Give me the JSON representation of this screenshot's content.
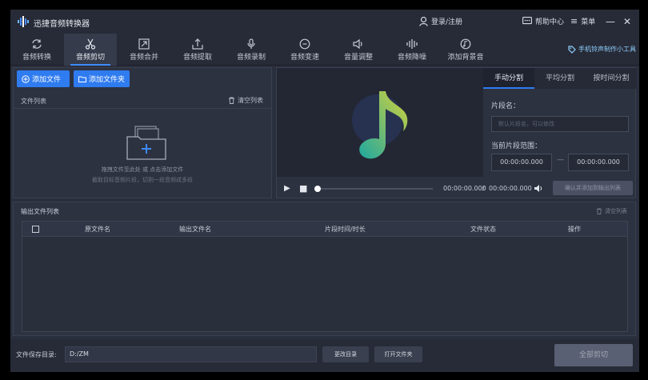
{
  "app": {
    "title": "迅捷音频转换器",
    "login": "登录/注册",
    "help": "帮助中心",
    "menu": "菜单",
    "accent": "#2f7bf0"
  },
  "toolbar": {
    "items": [
      {
        "label": "音频转换",
        "icon": "convert-icon"
      },
      {
        "label": "音频剪切",
        "icon": "scissors-icon"
      },
      {
        "label": "音频合并",
        "icon": "merge-icon"
      },
      {
        "label": "音频提取",
        "icon": "extract-icon"
      },
      {
        "label": "音频录制",
        "icon": "microphone-icon"
      },
      {
        "label": "音频变速",
        "icon": "speed-icon"
      },
      {
        "label": "音量调整",
        "icon": "volume-icon"
      },
      {
        "label": "音频降噪",
        "icon": "denoise-icon"
      },
      {
        "label": "添加背景音",
        "icon": "music-disc-icon"
      }
    ],
    "active": "音频剪切",
    "phone_tool": "手机铃声制作小工具"
  },
  "files": {
    "add_file": "添加文件",
    "add_folder": "添加文件夹",
    "list_label": "文件列表",
    "clear_list": "清空列表",
    "drop_hint_1": "拖拽文件至此处 或 点击添加文件",
    "drop_hint_2": "截取目标音频片段，切割一段音频成多段"
  },
  "player": {
    "current_time": "00:00:00.000",
    "separator": "/",
    "total_time": "00:00:00.000",
    "progress": 0,
    "confirm_button": "确认并添加到输出列表"
  },
  "split": {
    "tabs": [
      "手动分割",
      "平均分割",
      "按时间分割"
    ],
    "active_tab": "手动分割",
    "segment_name_label": "片段名：",
    "segment_name_placeholder": "默认片段名，可以修改",
    "range_label": "当前片段范围：",
    "start_time": "00:00:00.000",
    "range_dash": "—",
    "end_time": "00:00:00.000"
  },
  "output": {
    "title": "输出文件列表",
    "clear_list": "清空列表",
    "columns": [
      "原文件名",
      "输出文件名",
      "片段时间/时长",
      "文件状态",
      "操作"
    ]
  },
  "footer": {
    "save_dir_label": "文件保存目录:",
    "save_dir_value": "D:/ZM",
    "change_dir": "更改目录",
    "open_folder": "打开文件夹",
    "cut_all": "全部剪切"
  }
}
